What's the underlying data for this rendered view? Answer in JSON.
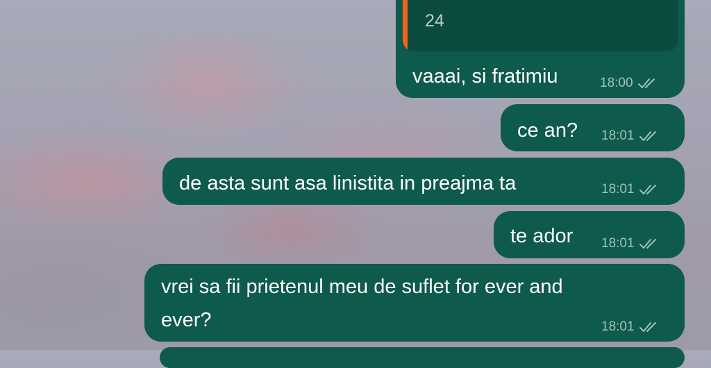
{
  "quoted_message": {
    "text": "24",
    "accent_color": "#f0641e"
  },
  "messages": [
    {
      "text": "vaaai, si fratimiu",
      "time": "18:00",
      "status": "read"
    },
    {
      "text": "ce an?",
      "time": "18:01",
      "status": "read"
    },
    {
      "text": "de asta sunt asa linistita in preajma ta",
      "time": "18:01",
      "status": "read"
    },
    {
      "text": "te ador",
      "time": "18:01",
      "status": "read"
    },
    {
      "text_line1": "vrei sa fii prietenul meu de suflet for ever and",
      "text_line2": "ever?",
      "time": "18:01",
      "status": "read"
    }
  ],
  "colors": {
    "bubble": "#0e5a4c",
    "quote_bg": "#0b4a3e",
    "meta": "#9fc3b9"
  },
  "icons": {
    "read_status": "double-check-icon"
  }
}
